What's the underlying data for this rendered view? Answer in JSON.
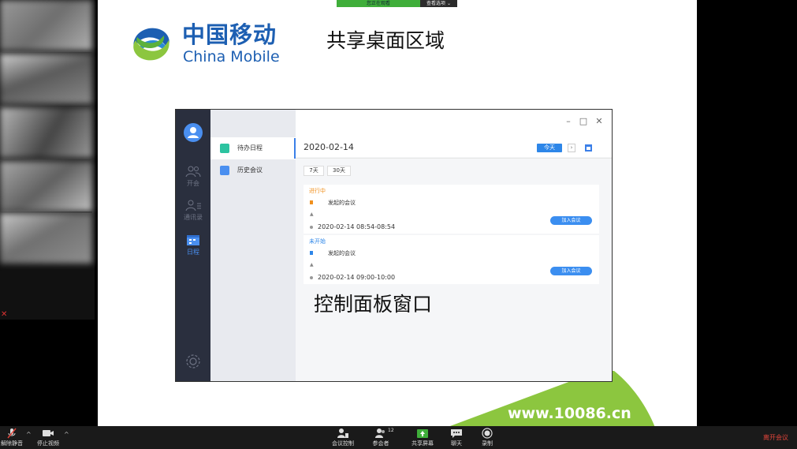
{
  "meeting_banner": {
    "notice": "您正在观看",
    "view_options": "查看选项 ⌄"
  },
  "slide": {
    "logo_cn": "中国移动",
    "logo_en": "China Mobile",
    "title": "共享桌面区域",
    "website": "www.10086.cn",
    "brand_blue": "#1d5fb2",
    "brand_green": "#8cc63f"
  },
  "app": {
    "nav": {
      "items": [
        {
          "label": "开会",
          "icon": "people-icon"
        },
        {
          "label": "通讯录",
          "icon": "contacts-icon"
        },
        {
          "label": "日程",
          "icon": "calendar-icon"
        }
      ]
    },
    "sidebar": {
      "items": [
        {
          "label": "待办日程",
          "icon": "todo-schedule-icon"
        },
        {
          "label": "历史会议",
          "icon": "history-meeting-icon"
        }
      ]
    },
    "main": {
      "date": "2020-02-14",
      "today_label": "今天",
      "next_label": "›",
      "ranges": [
        "7天",
        "30天"
      ],
      "meetings": [
        {
          "status": "进行中",
          "status_color": "#f0901e",
          "title": "发起的会议",
          "organizer": "",
          "time": "2020-02-14 08:54-08:54",
          "join_label": "加入会议"
        },
        {
          "status": "未开始",
          "status_color": "#2d86e8",
          "title": "发起的会议",
          "organizer": "",
          "time": "2020-02-14 09:00-10:00",
          "join_label": "加入会议"
        }
      ]
    },
    "panel_label": "控制面板窗口"
  },
  "toolbar": {
    "unmute": "解除静音",
    "stop_video": "停止视频",
    "meeting_control": "会议控制",
    "participants": "参会者",
    "participants_count": "12",
    "share_screen": "共享屏幕",
    "chat": "聊天",
    "record": "录制",
    "leave": "离开会议"
  }
}
